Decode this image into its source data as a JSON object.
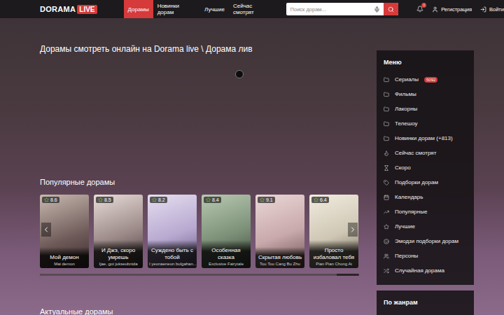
{
  "header": {
    "logo": {
      "text": "DORAMA",
      "badge": "LIVE"
    },
    "nav": [
      {
        "label": "Дорамы",
        "selected": true
      },
      {
        "label": "Новинки дорам",
        "selected": false
      },
      {
        "label": "Лучшие",
        "selected": false
      },
      {
        "label": "Сейчас смотрят",
        "selected": false
      }
    ],
    "search": {
      "placeholder": "Поиск дорам..."
    },
    "notifications": {
      "badge": "0"
    },
    "register": "Регистрация",
    "login": "Войти"
  },
  "page": {
    "title": "Дорамы смотреть онлайн на Dorama live \\ Дорама лив"
  },
  "popular": {
    "title": "Популярные дорамы",
    "prev": "‹",
    "next": "›",
    "scroll": 0.93,
    "cards": [
      {
        "rating": "8.6",
        "title": "Мой демон",
        "original": "Mai demon"
      },
      {
        "rating": "8.5",
        "title": "И Джэ, скоро умрешь",
        "original": "Ijae, got jukseubnida"
      },
      {
        "rating": "8.2",
        "title": "Суждено быть с тобой",
        "original": "I yeonaeneun bulgahan..."
      },
      {
        "rating": "8.4",
        "title": "Особенная сказка",
        "original": "Exclusive Fairytale"
      },
      {
        "rating": "9.1",
        "title": "Скрытая любовь",
        "original": "Tou Tou Cang Bu Zhu"
      },
      {
        "rating": "6.4",
        "title": "Просто избаловал тебя",
        "original": "Pian Pian Chong Ai"
      }
    ]
  },
  "actual": {
    "title": "Актуальные дорамы"
  },
  "sidebar": {
    "title": "Меню",
    "items": [
      {
        "label": "Сериалы",
        "badge": "5092"
      },
      {
        "label": "Фильмы"
      },
      {
        "label": "Лакорны"
      },
      {
        "label": "Телешоу"
      },
      {
        "label": "Новинки дорам (+813)"
      },
      {
        "label": "Сейчас смотрят"
      },
      {
        "label": "Скоро"
      },
      {
        "label": "Подборки дорам"
      },
      {
        "label": "Календарь"
      },
      {
        "label": "Популярные"
      },
      {
        "label": "Лучшие"
      },
      {
        "label": "Эмодзи подборки дорам"
      },
      {
        "label": "Персоны"
      },
      {
        "label": "Случайная дорама"
      }
    ],
    "genres_title": "По жанрам"
  }
}
